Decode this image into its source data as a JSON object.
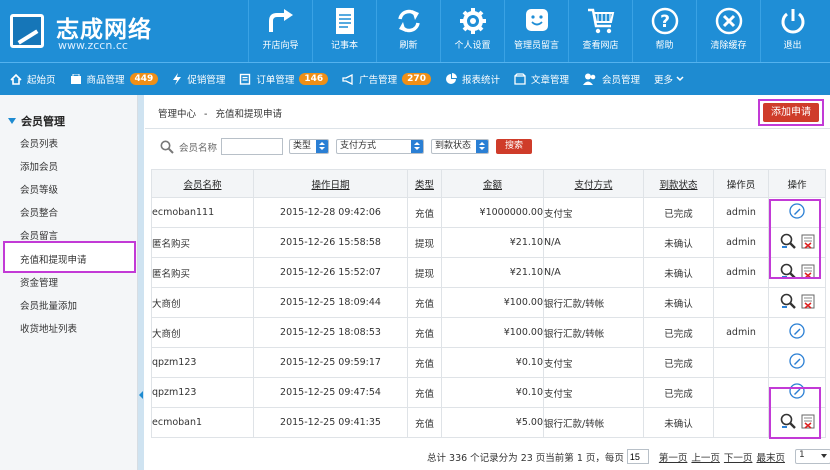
{
  "logo": {
    "title": "志成网络",
    "url": "www.zccn.cc"
  },
  "topnav": [
    {
      "label": "开店向导",
      "icon": "redo-arrow-icon"
    },
    {
      "label": "记事本",
      "icon": "notepad-icon"
    },
    {
      "label": "刷新",
      "icon": "refresh-icon"
    },
    {
      "label": "个人设置",
      "icon": "gear-icon"
    },
    {
      "label": "管理员留言",
      "icon": "smiley-message-icon"
    },
    {
      "label": "查看网店",
      "icon": "shopping-cart-icon"
    },
    {
      "label": "帮助",
      "icon": "help-icon"
    },
    {
      "label": "清除缓存",
      "icon": "clear-cache-icon"
    },
    {
      "label": "退出",
      "icon": "power-icon"
    }
  ],
  "menu": [
    {
      "label": "起始页",
      "icon": "home-icon",
      "badge": ""
    },
    {
      "label": "商品管理",
      "icon": "goods-icon",
      "badge": "449"
    },
    {
      "label": "促销管理",
      "icon": "lightning-icon",
      "badge": ""
    },
    {
      "label": "订单管理",
      "icon": "order-icon",
      "badge": "146"
    },
    {
      "label": "广告管理",
      "icon": "megaphone-icon",
      "badge": "270"
    },
    {
      "label": "报表统计",
      "icon": "pie-chart-icon",
      "badge": ""
    },
    {
      "label": "文章管理",
      "icon": "article-icon",
      "badge": ""
    },
    {
      "label": "会员管理",
      "icon": "users-icon",
      "badge": ""
    },
    {
      "label": "更多",
      "icon": "chevron-down-icon",
      "badge": ""
    }
  ],
  "sidebar": {
    "heading": "会员管理",
    "items": [
      "会员列表",
      "添加会员",
      "会员等级",
      "会员整合",
      "会员留言",
      "充值和提现申请",
      "资金管理",
      "会员批量添加",
      "收货地址列表"
    ]
  },
  "breadcrumb": {
    "root": "管理中心",
    "sep": "-",
    "current": "充值和提现申请"
  },
  "action_button": "添加申请",
  "search": {
    "label": "会员名称",
    "name_value": "",
    "type_select": "类型",
    "payment_select": "支付方式",
    "status_select": "到款状态",
    "button": "搜索"
  },
  "table": {
    "headers": [
      "会员名称",
      "操作日期",
      "类型",
      "金额",
      "支付方式",
      "到款状态",
      "操作员",
      "操作"
    ],
    "rows": [
      {
        "user": "ecmoban111",
        "date": "2015-12-28 09:42:06",
        "type": "充值",
        "amount": "¥1000000.00",
        "payment": "支付宝",
        "status": "已完成",
        "operator": "admin",
        "ops": [
          "edit"
        ]
      },
      {
        "user": "匿名购买",
        "date": "2015-12-26 15:58:58",
        "type": "提现",
        "amount": "¥21.10",
        "payment": "N/A",
        "status": "未确认",
        "operator": "admin",
        "ops": [
          "view",
          "remove"
        ]
      },
      {
        "user": "匿名购买",
        "date": "2015-12-26 15:52:07",
        "type": "提现",
        "amount": "¥21.10",
        "payment": "N/A",
        "status": "未确认",
        "operator": "admin",
        "ops": [
          "view",
          "remove"
        ]
      },
      {
        "user": "大商创",
        "date": "2015-12-25 18:09:44",
        "type": "充值",
        "amount": "¥100.00",
        "payment": "银行汇款/转帐",
        "status": "未确认",
        "operator": "",
        "ops": [
          "view",
          "remove"
        ]
      },
      {
        "user": "大商创",
        "date": "2015-12-25 18:08:53",
        "type": "充值",
        "amount": "¥100.00",
        "payment": "银行汇款/转帐",
        "status": "已完成",
        "operator": "admin",
        "ops": [
          "edit"
        ]
      },
      {
        "user": "qpzm123",
        "date": "2015-12-25 09:59:17",
        "type": "充值",
        "amount": "¥0.10",
        "payment": "支付宝",
        "status": "已完成",
        "operator": "",
        "ops": [
          "edit"
        ]
      },
      {
        "user": "qpzm123",
        "date": "2015-12-25 09:47:54",
        "type": "充值",
        "amount": "¥0.10",
        "payment": "支付宝",
        "status": "已完成",
        "operator": "",
        "ops": [
          "edit"
        ]
      },
      {
        "user": "ecmoban1",
        "date": "2015-12-25 09:41:35",
        "type": "充值",
        "amount": "¥5.00",
        "payment": "银行汇款/转帐",
        "status": "未确认",
        "operator": "",
        "ops": [
          "view",
          "remove"
        ]
      }
    ]
  },
  "pagination": {
    "summary": "总计 336 个记录分为 23 页当前第 1 页，每页",
    "per_page": "15",
    "first": "第一页",
    "prev": "上一页",
    "next": "下一页",
    "last": "最末页",
    "page": "1"
  },
  "colors": {
    "header": "#1f8ed6",
    "menubar": "#1e8bd1",
    "accent_red": "#cf3c2a",
    "badge": "#f08f17",
    "highlight": "#c23ad6"
  }
}
